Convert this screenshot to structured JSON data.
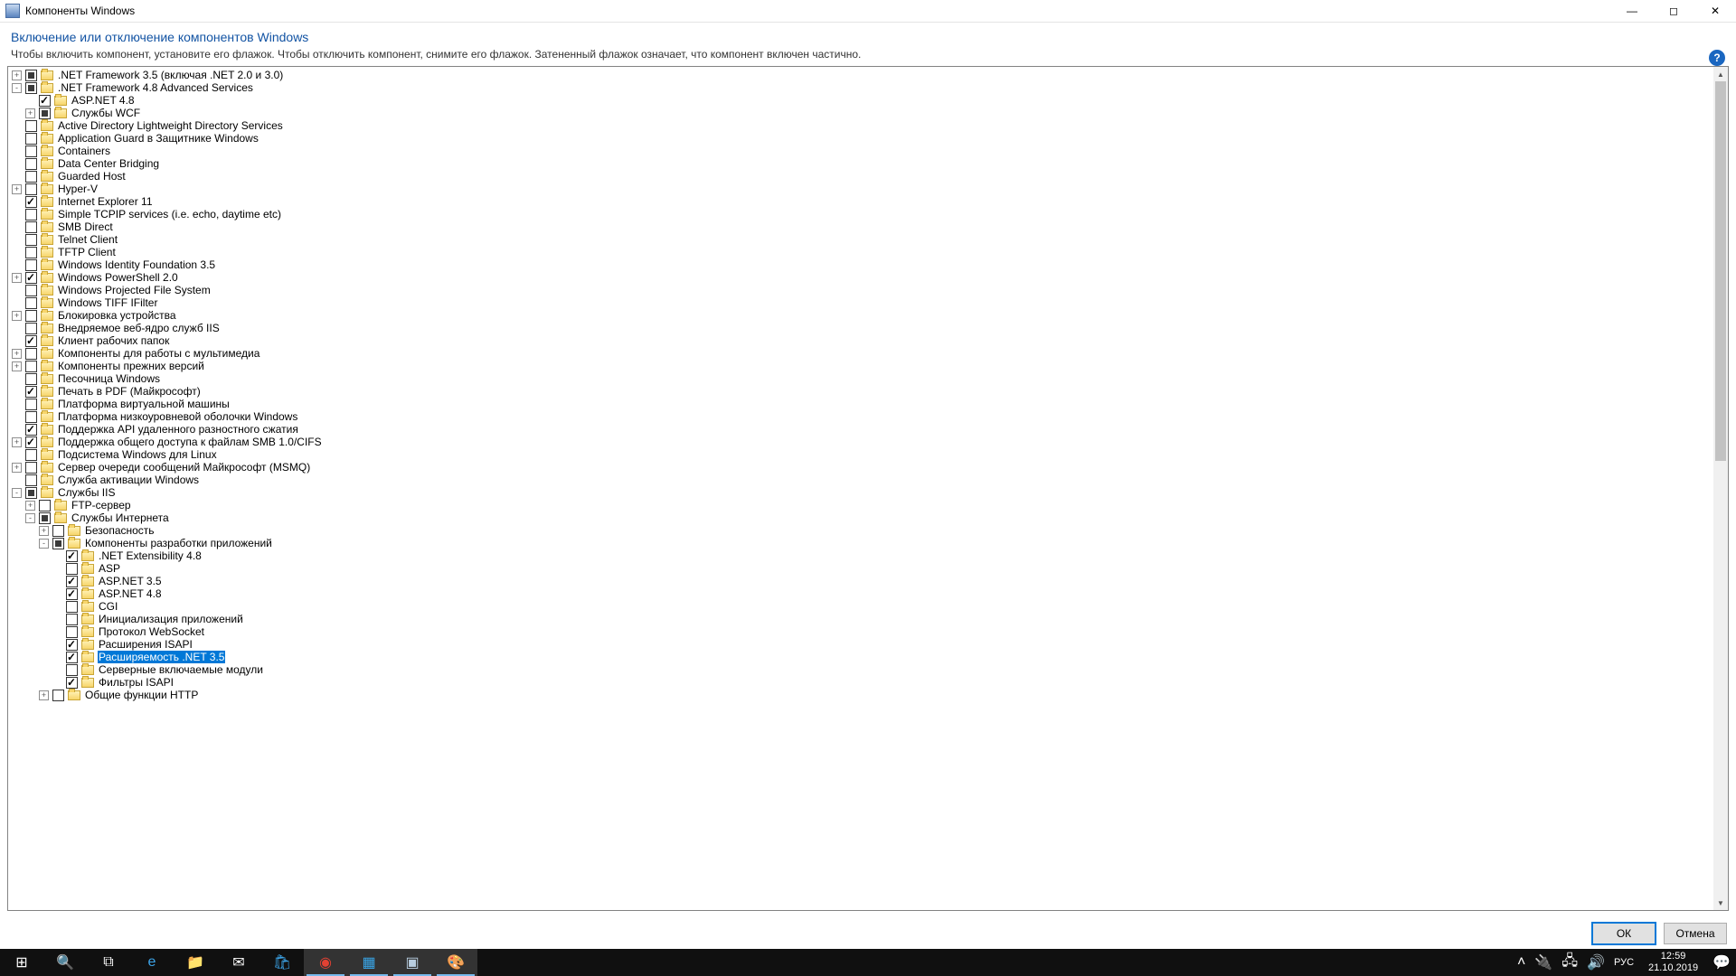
{
  "window": {
    "title": "Компоненты Windows",
    "min_glyph": "—",
    "max_glyph": "◻",
    "close_glyph": "✕"
  },
  "header": {
    "title": "Включение или отключение компонентов Windows",
    "subtitle": "Чтобы включить компонент, установите его флажок. Чтобы отключить компонент, снимите его флажок. Затененный флажок означает, что компонент включен частично.",
    "help_glyph": "?"
  },
  "scrollbar": {
    "up": "▲",
    "down": "▼"
  },
  "buttons": {
    "ok": "ОК",
    "cancel": "Отмена"
  },
  "tree": [
    {
      "d": 0,
      "ex": "+",
      "cb": "ind",
      "t": ".NET Framework 3.5 (включая .NET 2.0 и 3.0)"
    },
    {
      "d": 0,
      "ex": "-",
      "cb": "ind",
      "t": ".NET Framework 4.8 Advanced Services"
    },
    {
      "d": 1,
      "ex": " ",
      "cb": "chk",
      "t": "ASP.NET 4.8"
    },
    {
      "d": 1,
      "ex": "+",
      "cb": "ind",
      "t": "Службы WCF"
    },
    {
      "d": 0,
      "ex": " ",
      "cb": "off",
      "t": "Active Directory Lightweight Directory Services"
    },
    {
      "d": 0,
      "ex": " ",
      "cb": "off",
      "t": "Application Guard в Защитнике Windows"
    },
    {
      "d": 0,
      "ex": " ",
      "cb": "off",
      "t": "Containers"
    },
    {
      "d": 0,
      "ex": " ",
      "cb": "off",
      "t": "Data Center Bridging"
    },
    {
      "d": 0,
      "ex": " ",
      "cb": "off",
      "t": "Guarded Host"
    },
    {
      "d": 0,
      "ex": "+",
      "cb": "off",
      "t": "Hyper-V"
    },
    {
      "d": 0,
      "ex": " ",
      "cb": "chk",
      "t": "Internet Explorer 11"
    },
    {
      "d": 0,
      "ex": " ",
      "cb": "off",
      "t": "Simple TCPIP services (i.e. echo, daytime etc)"
    },
    {
      "d": 0,
      "ex": " ",
      "cb": "off",
      "t": "SMB Direct"
    },
    {
      "d": 0,
      "ex": " ",
      "cb": "off",
      "t": "Telnet Client"
    },
    {
      "d": 0,
      "ex": " ",
      "cb": "off",
      "t": "TFTP Client"
    },
    {
      "d": 0,
      "ex": " ",
      "cb": "off",
      "t": "Windows Identity Foundation 3.5"
    },
    {
      "d": 0,
      "ex": "+",
      "cb": "chk",
      "t": "Windows PowerShell 2.0"
    },
    {
      "d": 0,
      "ex": " ",
      "cb": "off",
      "t": "Windows Projected File System"
    },
    {
      "d": 0,
      "ex": " ",
      "cb": "off",
      "t": "Windows TIFF IFilter"
    },
    {
      "d": 0,
      "ex": "+",
      "cb": "off",
      "t": "Блокировка устройства"
    },
    {
      "d": 0,
      "ex": " ",
      "cb": "off",
      "t": "Внедряемое веб-ядро служб IIS"
    },
    {
      "d": 0,
      "ex": " ",
      "cb": "chk",
      "t": "Клиент рабочих папок"
    },
    {
      "d": 0,
      "ex": "+",
      "cb": "off",
      "t": "Компоненты для работы с мультимедиа"
    },
    {
      "d": 0,
      "ex": "+",
      "cb": "off",
      "t": "Компоненты прежних версий"
    },
    {
      "d": 0,
      "ex": " ",
      "cb": "off",
      "t": "Песочница Windows"
    },
    {
      "d": 0,
      "ex": " ",
      "cb": "chk",
      "t": "Печать в PDF (Майкрософт)"
    },
    {
      "d": 0,
      "ex": " ",
      "cb": "off",
      "t": "Платформа виртуальной машины"
    },
    {
      "d": 0,
      "ex": " ",
      "cb": "off",
      "t": "Платформа низкоуровневой оболочки Windows"
    },
    {
      "d": 0,
      "ex": " ",
      "cb": "chk",
      "t": "Поддержка API удаленного разностного сжатия"
    },
    {
      "d": 0,
      "ex": "+",
      "cb": "chk",
      "t": "Поддержка общего доступа к файлам SMB 1.0/CIFS"
    },
    {
      "d": 0,
      "ex": " ",
      "cb": "off",
      "t": "Подсистема Windows для Linux"
    },
    {
      "d": 0,
      "ex": "+",
      "cb": "off",
      "t": "Сервер очереди сообщений Майкрософт (MSMQ)"
    },
    {
      "d": 0,
      "ex": " ",
      "cb": "off",
      "t": "Служба активации Windows"
    },
    {
      "d": 0,
      "ex": "-",
      "cb": "ind",
      "t": "Службы IIS"
    },
    {
      "d": 1,
      "ex": "+",
      "cb": "off",
      "t": "FTP-сервер"
    },
    {
      "d": 1,
      "ex": "-",
      "cb": "ind",
      "t": "Службы Интернета"
    },
    {
      "d": 2,
      "ex": "+",
      "cb": "off",
      "t": "Безопасность"
    },
    {
      "d": 2,
      "ex": "-",
      "cb": "ind",
      "t": "Компоненты разработки приложений"
    },
    {
      "d": 3,
      "ex": " ",
      "cb": "chk",
      "t": ".NET Extensibility 4.8"
    },
    {
      "d": 3,
      "ex": " ",
      "cb": "off",
      "t": "ASP"
    },
    {
      "d": 3,
      "ex": " ",
      "cb": "chk",
      "t": "ASP.NET 3.5"
    },
    {
      "d": 3,
      "ex": " ",
      "cb": "chk",
      "t": "ASP.NET 4.8"
    },
    {
      "d": 3,
      "ex": " ",
      "cb": "off",
      "t": "CGI"
    },
    {
      "d": 3,
      "ex": " ",
      "cb": "off",
      "t": "Инициализация приложений"
    },
    {
      "d": 3,
      "ex": " ",
      "cb": "off",
      "t": "Протокол WebSocket"
    },
    {
      "d": 3,
      "ex": " ",
      "cb": "chk",
      "t": "Расширения ISAPI"
    },
    {
      "d": 3,
      "ex": " ",
      "cb": "chk",
      "t": "Расширяемость .NET 3.5",
      "sel": true
    },
    {
      "d": 3,
      "ex": " ",
      "cb": "off",
      "t": "Серверные включаемые модули"
    },
    {
      "d": 3,
      "ex": " ",
      "cb": "chk",
      "t": "Фильтры ISAPI"
    },
    {
      "d": 2,
      "ex": "+",
      "cb": "off",
      "t": "Общие функции HTTP"
    }
  ],
  "taskbar": {
    "apps": [
      {
        "name": "start",
        "glyph": "⊞",
        "color": "#ffffff"
      },
      {
        "name": "search",
        "glyph": "🔍",
        "color": "#ffffff"
      },
      {
        "name": "taskview",
        "glyph": "⧉",
        "color": "#ffffff"
      },
      {
        "name": "edge",
        "glyph": "e",
        "color": "#3ca4e8",
        "active": false
      },
      {
        "name": "explorer",
        "glyph": "📁",
        "color": "#f7d56b",
        "active": false
      },
      {
        "name": "mail",
        "glyph": "✉",
        "color": "#ffffff",
        "active": false
      },
      {
        "name": "store",
        "glyph": "🛍",
        "color": "#3ca4e8",
        "active": false
      },
      {
        "name": "chrome",
        "glyph": "◉",
        "color": "#e34133",
        "active": true
      },
      {
        "name": "hwmon",
        "glyph": "▦",
        "color": "#39a6e8",
        "active": true
      },
      {
        "name": "optionalfeatures",
        "glyph": "▣",
        "color": "#b8cde0",
        "active": true
      },
      {
        "name": "paint",
        "glyph": "🎨",
        "color": "#f0a030",
        "active": true
      }
    ],
    "tray": {
      "chevron": "˄",
      "power": "🔌",
      "net": "🖧",
      "sound": "🔊",
      "lang": "РУС",
      "time": "12:59",
      "date": "21.10.2019",
      "notif": "💬"
    }
  }
}
